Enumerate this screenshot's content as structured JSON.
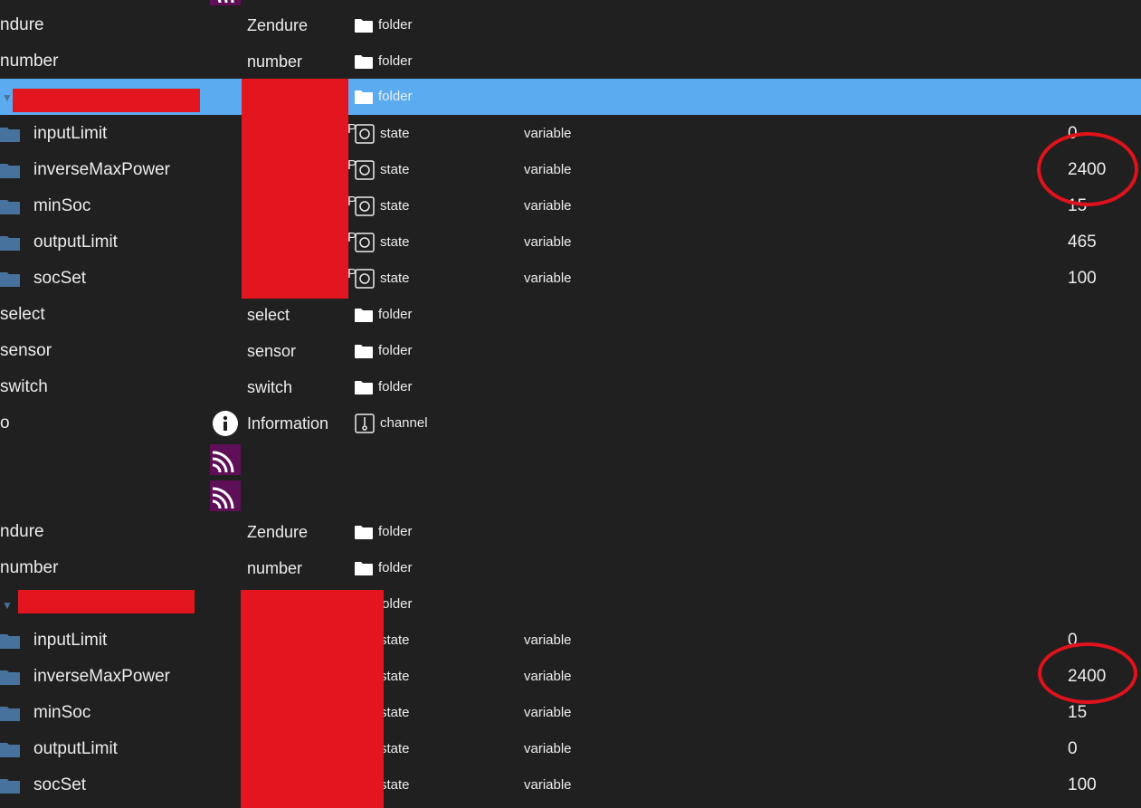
{
  "colors": {
    "background": "#202020",
    "selected_row": "#5aabf0",
    "folder_icon": "#47729d",
    "redaction": "#e3161f",
    "annotation_circle": "#e0121b",
    "logo": "#5e0f57"
  },
  "rows": [
    {
      "name": "ndure",
      "label": "Zendure",
      "type": "folder",
      "icon": "folder-icon"
    },
    {
      "name": "number",
      "label": "number",
      "type": "folder",
      "icon": "folder-icon"
    },
    {
      "name": "",
      "label": "",
      "type": "folder",
      "icon": "folder-icon"
    },
    {
      "name": "inputLimit",
      "type": "state",
      "role": "variable",
      "value": "0"
    },
    {
      "name": "inverseMaxPower",
      "type": "state",
      "role": "variable",
      "value": "2400"
    },
    {
      "name": "minSoc",
      "type": "state",
      "role": "variable",
      "value": "15"
    },
    {
      "name": "outputLimit",
      "type": "state",
      "role": "variable",
      "value": "465"
    },
    {
      "name": "socSet",
      "type": "state",
      "role": "variable",
      "value": "100"
    },
    {
      "name": "select",
      "label": "select",
      "type": "folder",
      "icon": "folder-icon"
    },
    {
      "name": "sensor",
      "label": "sensor",
      "type": "folder",
      "icon": "folder-icon"
    },
    {
      "name": "switch",
      "label": "switch",
      "type": "folder",
      "icon": "folder-icon"
    },
    {
      "name": "o",
      "label": "Information",
      "type": "channel",
      "icon": "channel-icon"
    },
    {
      "name": "ndure",
      "label": "Zendure",
      "type": "folder",
      "icon": "folder-icon"
    },
    {
      "name": "number",
      "label": "number",
      "type": "folder",
      "icon": "folder-icon"
    },
    {
      "name": "",
      "label": "",
      "type": "folder",
      "icon": "folder-icon"
    },
    {
      "name": "inputLimit",
      "type": "state",
      "role": "variable",
      "value": "0"
    },
    {
      "name": "inverseMaxPower",
      "type": "state",
      "role": "variable",
      "value": "2400"
    },
    {
      "name": "minSoc",
      "type": "state",
      "role": "variable",
      "value": "15"
    },
    {
      "name": "outputLimit",
      "type": "state",
      "role": "variable",
      "value": "0"
    },
    {
      "name": "socSet",
      "type": "state",
      "role": "variable",
      "value": "100"
    }
  ]
}
